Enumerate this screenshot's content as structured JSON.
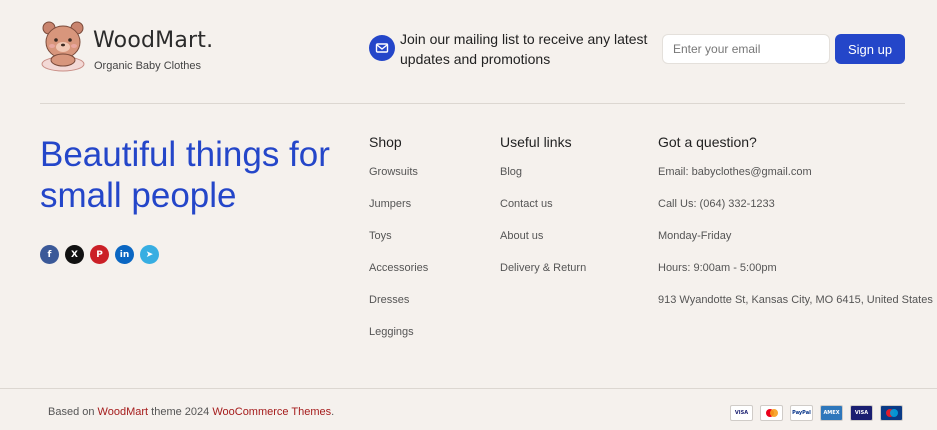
{
  "brand": {
    "name": "WoodMart.",
    "subtitle": "Organic Baby Clothes",
    "logo_icon": "teddy-bear-icon"
  },
  "newsletter": {
    "icon": "envelope-icon",
    "text": "Join our mailing list to receive any latest updates and promotions",
    "email_placeholder": "Enter your email",
    "email_value": "",
    "button_label": "Sign up"
  },
  "tagline": "Beautiful things for small people",
  "social": [
    {
      "icon": "facebook-icon",
      "glyph": "f"
    },
    {
      "icon": "x-icon",
      "glyph": "X"
    },
    {
      "icon": "pinterest-icon",
      "glyph": "P"
    },
    {
      "icon": "linkedin-icon",
      "glyph": "in"
    },
    {
      "icon": "telegram-icon",
      "glyph": "➤"
    }
  ],
  "shop": {
    "title": "Shop",
    "items": [
      "Growsuits",
      "Jumpers",
      "Toys",
      "Accessories",
      "Dresses",
      "Leggings"
    ]
  },
  "useful_links": {
    "title": "Useful links",
    "items": [
      "Blog",
      "Contact us",
      "About us",
      "Delivery & Return"
    ]
  },
  "question": {
    "title": "Got a question?",
    "items": [
      "Email: babyclothes@gmail.com",
      "Call Us: (064) 332-1233",
      "Monday-Friday",
      "Hours: 9:00am - 5:00pm",
      "913 Wyandotte St, Kansas City, MO 6415, United States"
    ]
  },
  "footer": {
    "prefix": "Based on",
    "theme_link": "WoodMart",
    "middle": "theme 2024",
    "themes_link": "WooCommerce Themes",
    "suffix": "."
  },
  "payments": [
    {
      "icon": "visa-icon",
      "label": "VISA"
    },
    {
      "icon": "mastercard-icon",
      "label": ""
    },
    {
      "icon": "paypal-icon",
      "label": "PayPal"
    },
    {
      "icon": "amex-icon",
      "label": "AMEX"
    },
    {
      "icon": "visa-electron-icon",
      "label": "VISA"
    },
    {
      "icon": "maestro-icon",
      "label": ""
    }
  ],
  "colors": {
    "accent": "#2446c9",
    "background": "#f5f1ed",
    "link": "#a51c1c"
  }
}
